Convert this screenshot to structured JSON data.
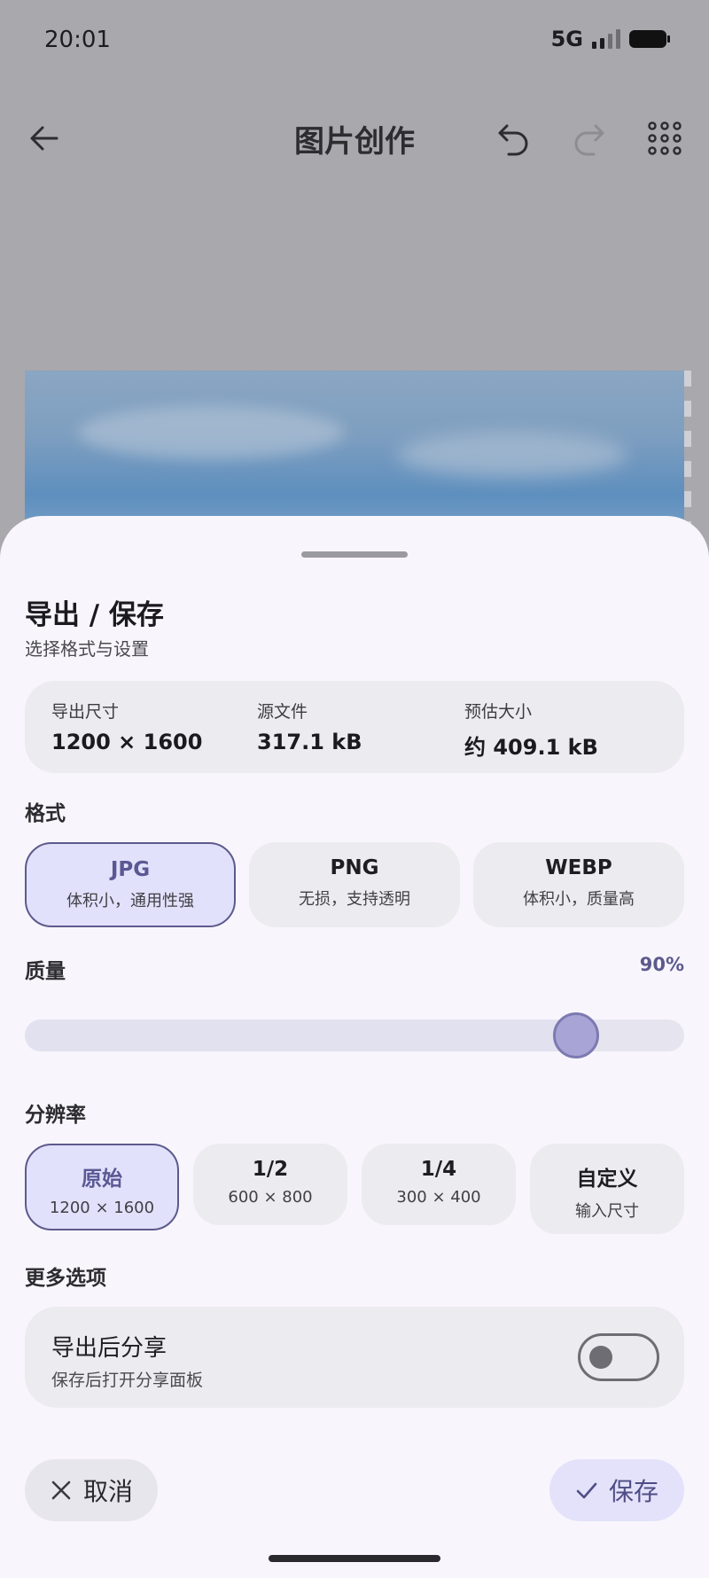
{
  "status_bar": {
    "time": "20:01",
    "network": "5G"
  },
  "app_bar": {
    "title": "图片创作"
  },
  "sheet": {
    "title": "导出 / 保存",
    "subtitle": "选择格式与设置",
    "info": [
      {
        "label": "导出尺寸",
        "value": "1200 × 1600"
      },
      {
        "label": "源文件",
        "value": "317.1 kB"
      },
      {
        "label": "预估大小",
        "value": "约 409.1 kB"
      }
    ],
    "format": {
      "label": "格式",
      "options": [
        {
          "name": "JPG",
          "desc": "体积小，通用性强",
          "selected": true
        },
        {
          "name": "PNG",
          "desc": "无损，支持透明",
          "selected": false
        },
        {
          "name": "WEBP",
          "desc": "体积小，质量高",
          "selected": false
        }
      ]
    },
    "quality": {
      "label": "质量",
      "value_text": "90%",
      "value": 0.9
    },
    "resolution": {
      "label": "分辨率",
      "options": [
        {
          "name": "原始",
          "desc": "1200 × 1600",
          "selected": true
        },
        {
          "name": "1/2",
          "desc": "600 × 800",
          "selected": false
        },
        {
          "name": "1/4",
          "desc": "300 × 400",
          "selected": false
        },
        {
          "name": "自定义",
          "desc": "输入尺寸",
          "selected": false
        }
      ]
    },
    "more": {
      "label": "更多选项",
      "share_title": "导出后分享",
      "share_desc": "保存后打开分享面板",
      "share_enabled": false
    },
    "cancel_label": "取消",
    "save_label": "保存"
  },
  "colors": {
    "accent": "#5c5a8c",
    "sheet_bg": "#f8f6fc",
    "card_bg": "#ecebf0"
  }
}
